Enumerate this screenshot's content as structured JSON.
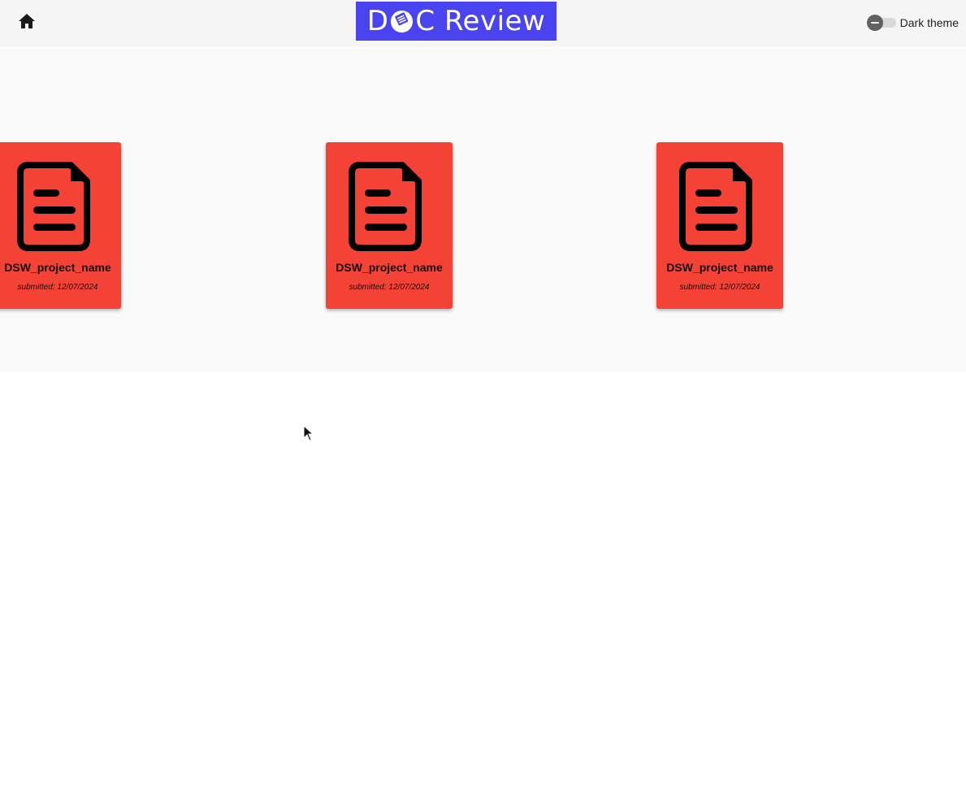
{
  "header": {
    "home_icon": "home-icon",
    "logo": {
      "text_left": "D",
      "text_right": "C Review",
      "background": "#4a44f0"
    },
    "theme_toggle": {
      "label": "Dark theme",
      "checked": false
    }
  },
  "documents": [
    {
      "name": "DSW_project_name",
      "submitted": "submitted: 12/07/2024",
      "icon": "document-icon"
    },
    {
      "name": "DSW_project_name",
      "submitted": "submitted: 12/07/2024",
      "icon": "document-icon"
    },
    {
      "name": "DSW_project_name",
      "submitted": "submitted: 12/07/2024",
      "icon": "document-icon"
    }
  ],
  "colors": {
    "card": "#f44336",
    "header": "#f5f5f5",
    "panel": "#fafafa"
  }
}
